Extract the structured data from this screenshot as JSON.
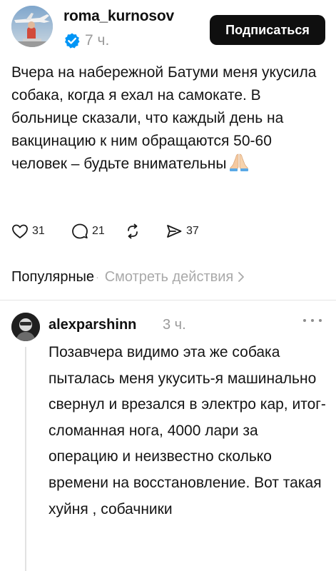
{
  "post": {
    "author": "roma_kurnosov",
    "time": "7 ч.",
    "follow_label": "Подписаться",
    "text": "Вчера на набережной Батуми меня укусила собака, когда я ехал на самокате. В больнице сказали, что каждый день на вакцинацию к ним обращаются 50-60 человек – будьте внимательны",
    "emoji": "folded-hands",
    "stats": {
      "likes": "31",
      "replies": "21",
      "shares": "37"
    }
  },
  "replies_header": {
    "sort_label": "Популярные",
    "separator": "·",
    "view_activity_label": "Смотреть действия"
  },
  "comment": {
    "author": "alexparshinn",
    "time": "3 ч.",
    "text": "Позавчера видимо эта же собака пыталась меня укусить-я машинально свернул и врезался в электро кар, итог-сломанная нога, 4000 лари за операцию и неизвестно сколько времени на восстановление. Вот такая хуйня , собачники"
  },
  "icons": {
    "verified": "verified-badge-icon",
    "like": "heart-icon",
    "reply": "comment-bubble-icon",
    "repost": "repost-icon",
    "share": "send-icon",
    "more": "more-dots-icon",
    "chevron": "chevron-right-icon"
  },
  "colors": {
    "verified_blue": "#0095f6",
    "button_bg": "#0f0f0f",
    "muted_text": "#9a9a9a"
  }
}
